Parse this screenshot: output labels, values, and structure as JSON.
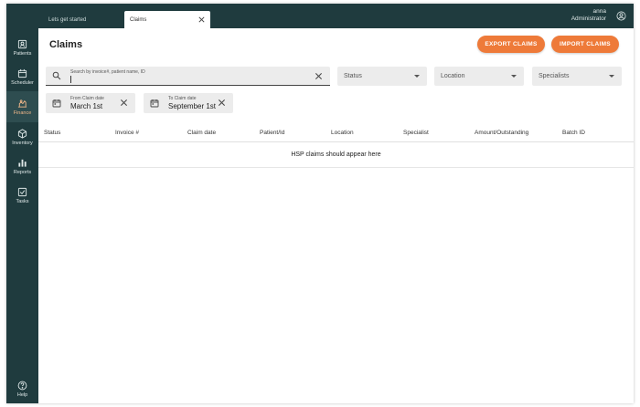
{
  "sidebar": {
    "items": [
      {
        "label": "Patients",
        "icon": "patients-icon"
      },
      {
        "label": "Scheduler",
        "icon": "calendar-icon"
      },
      {
        "label": "Finance",
        "icon": "finance-icon",
        "active": true
      },
      {
        "label": "Inventory",
        "icon": "box-icon"
      },
      {
        "label": "Reports",
        "icon": "bar-chart-icon"
      },
      {
        "label": "Tasks",
        "icon": "checkbox-icon"
      }
    ],
    "help_label": "Help"
  },
  "tabs": [
    {
      "label": "Lets get started"
    },
    {
      "label": "Claims"
    }
  ],
  "user": {
    "name": "anna",
    "role": "Administrator"
  },
  "page": {
    "title": "Claims"
  },
  "actions": {
    "export_label": "EXPORT CLAIMS",
    "import_label": "IMPORT CLAIMS"
  },
  "search": {
    "placeholder": "Search by invoice#, patient name, ID",
    "value": ""
  },
  "filters": {
    "status": "Status",
    "location": "Location",
    "specialists": "Specialists"
  },
  "dates": {
    "from": {
      "label": "From Claim date",
      "value": "March 1st"
    },
    "to": {
      "label": "To Claim date",
      "value": "September 1st"
    }
  },
  "table": {
    "columns": [
      "Status",
      "Invoice #",
      "Claim date",
      "Patient/Id",
      "Location",
      "Specialist",
      "Amount/Outstanding",
      "Batch ID"
    ],
    "empty_message": "HSP claims should appear here"
  },
  "colors": {
    "sidebar": "#1f3b3e",
    "accent": "#ee7a39",
    "active": "#f2b88a"
  }
}
